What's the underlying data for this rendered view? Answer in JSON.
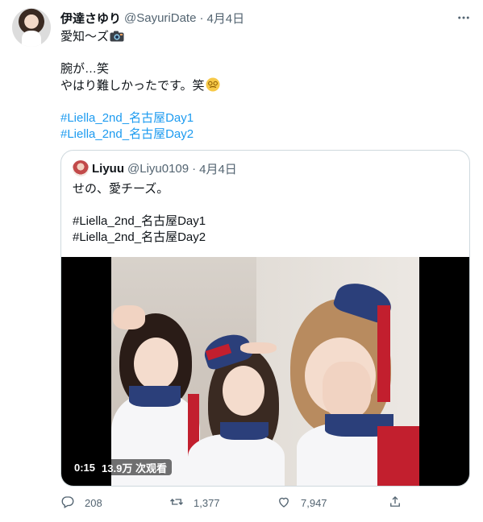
{
  "tweet": {
    "display_name": "伊達さゆり",
    "handle": "@SayuriDate",
    "separator": "·",
    "date": "4月4日",
    "lines": [
      "愛知〜ズ",
      "",
      "腕が…笑",
      "やはり難しかったです。笑",
      ""
    ],
    "hashtags": [
      "#Liella_2nd_名古屋Day1",
      "#Liella_2nd_名古屋Day2"
    ],
    "emoji_after_line1": "camera-emoji",
    "emoji_after_line4": "dizzy-face-emoji"
  },
  "quote": {
    "display_name": "Liyuu",
    "handle": "@Liyu0109",
    "separator": "·",
    "date": "4月4日",
    "lines": [
      "せの、愛チーズ。",
      "",
      "#Liella_2nd_名古屋Day1",
      "#Liella_2nd_名古屋Day2"
    ],
    "video": {
      "timestamp": "0:15",
      "views": "13.9万 次观看"
    }
  },
  "actions": {
    "reply_count": "208",
    "retweet_count": "1,377",
    "like_count": "7,947"
  },
  "icons": [
    "more-icon",
    "reply-icon",
    "retweet-icon",
    "like-icon",
    "share-icon"
  ],
  "colors": {
    "link": "#1d9bf0",
    "secondary_text": "#536471",
    "border": "#cfd9de"
  }
}
